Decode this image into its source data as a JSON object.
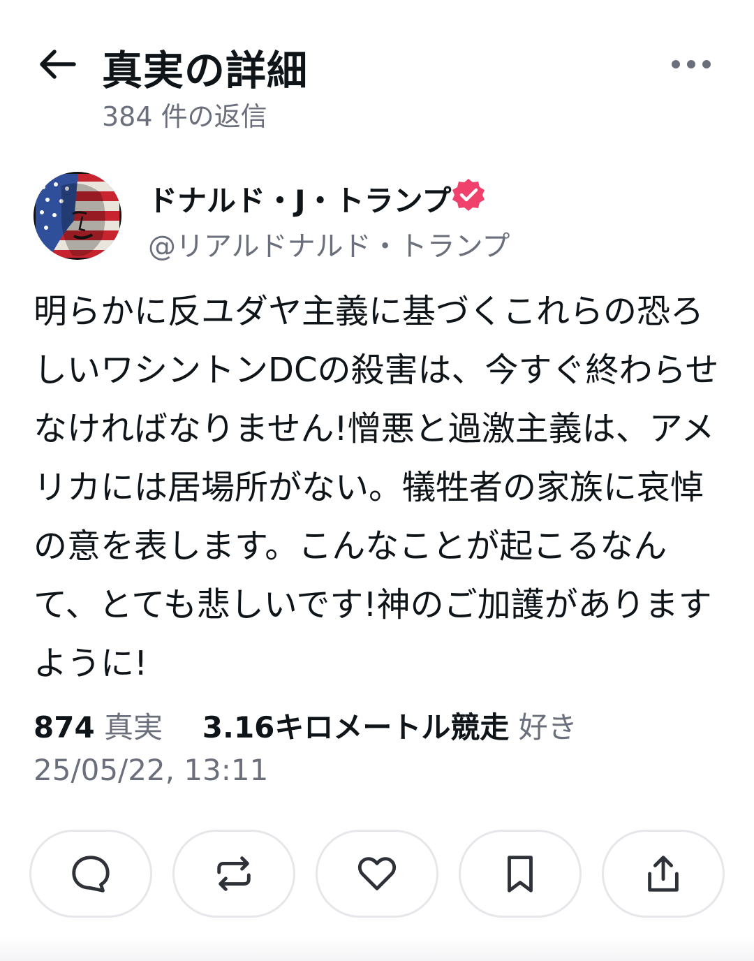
{
  "header": {
    "title": "真実の詳細",
    "reply_count": "384 件の返信",
    "back_icon": "arrow-left-icon",
    "more_icon": "ellipsis-icon"
  },
  "author": {
    "name": "ドナルド・J・トランプ",
    "handle": "@リアルドナルド・トランプ",
    "verified_color": "#f0416c"
  },
  "post": {
    "text": "明らかに反ユダヤ主義に基づくこれらの恐ろしいワシントンDCの殺害は、今すぐ終わらせなければなりません!憎悪と過激主義は、アメリカには居場所がない。犠牲者の家族に哀悼の意を表します。こんなことが起こるなんて、とても悲しいです!神のご加護がありますように!"
  },
  "stats": {
    "truths_count": "874",
    "truths_label": "真実",
    "likes_count": "3.16キロメートル競走",
    "likes_label": "好き",
    "timestamp": "25/05/22, 13:11"
  },
  "actions": [
    {
      "icon": "reply-icon"
    },
    {
      "icon": "retruth-icon"
    },
    {
      "icon": "heart-icon"
    },
    {
      "icon": "bookmark-icon"
    },
    {
      "icon": "share-icon"
    }
  ],
  "colors": {
    "text": "#0f1419",
    "muted": "#6b6f7b",
    "border": "#e6e7ea"
  }
}
